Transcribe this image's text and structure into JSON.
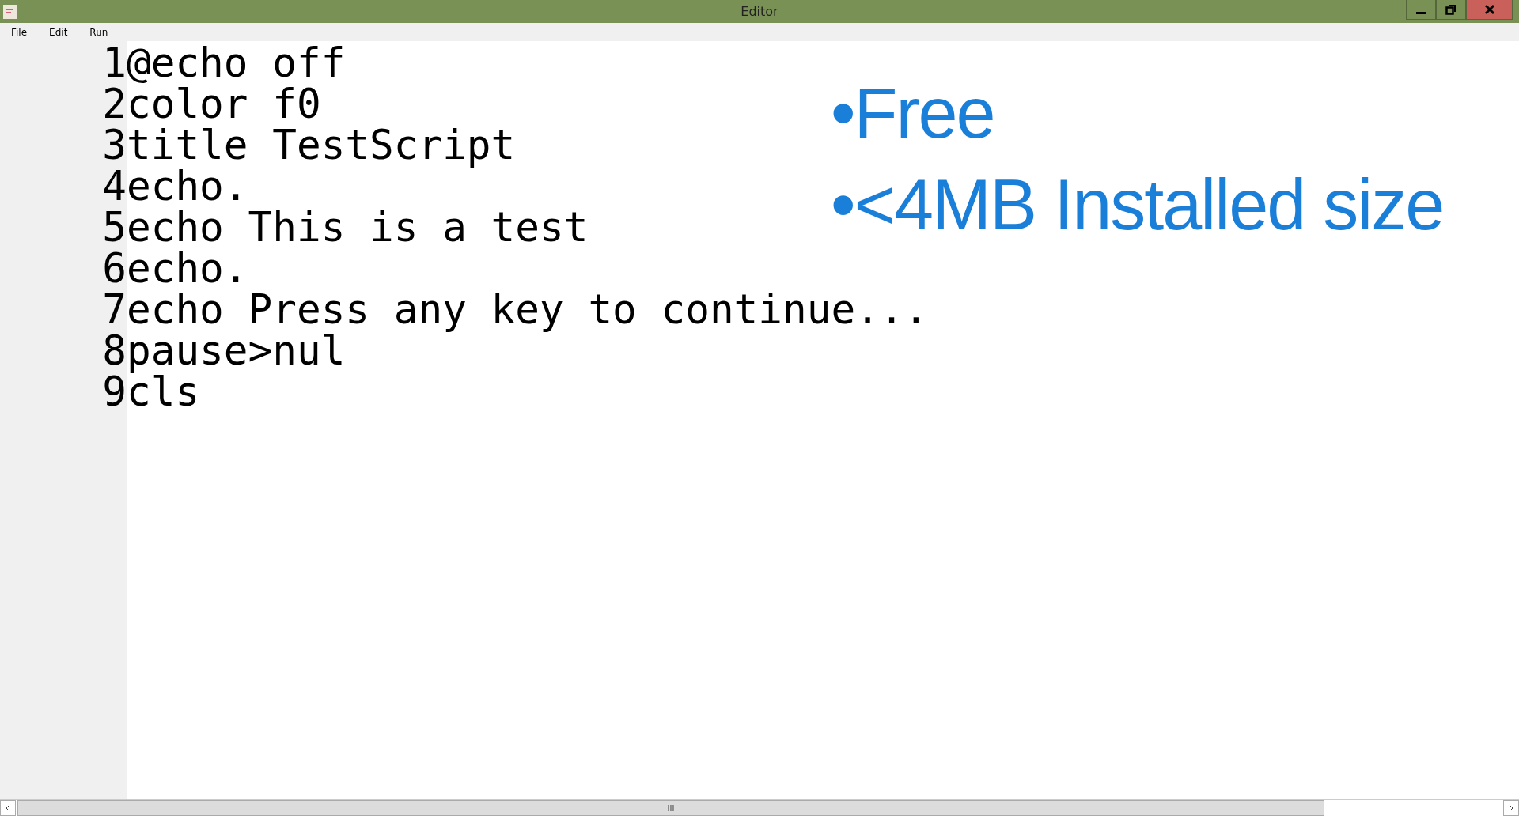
{
  "window": {
    "title": "Editor"
  },
  "menu": [
    "File",
    "Edit",
    "Run"
  ],
  "lines": [
    {
      "number": "1",
      "code": "@echo off"
    },
    {
      "number": "2",
      "code": "color f0"
    },
    {
      "number": "3",
      "code": "title TestScript"
    },
    {
      "number": "4",
      "code": "echo."
    },
    {
      "number": "5",
      "code": "echo This is a test"
    },
    {
      "number": "6",
      "code": "echo."
    },
    {
      "number": "7",
      "code": "echo Press any key to continue..."
    },
    {
      "number": "8",
      "code": "pause>nul"
    },
    {
      "number": "9",
      "code": "cls"
    }
  ],
  "overlay": [
    "•Free",
    "•<4MB Installed size"
  ],
  "scrollbar": {
    "grip": "III"
  }
}
